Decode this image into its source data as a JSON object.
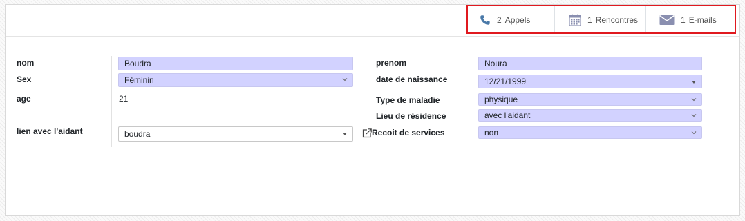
{
  "smart_buttons": [
    {
      "count": "2",
      "label": "Appels",
      "icon": "phone-icon"
    },
    {
      "count": "1",
      "label": "Rencontres",
      "icon": "calendar-icon"
    },
    {
      "count": "1",
      "label": "E-mails",
      "icon": "envelope-icon"
    }
  ],
  "form": {
    "nom": {
      "label": "nom",
      "value": "Boudra"
    },
    "sex": {
      "label": "Sex",
      "value": "Féminin"
    },
    "age": {
      "label": "age",
      "value": "21"
    },
    "lien": {
      "label": "lien avec l'aidant",
      "value": "boudra"
    },
    "prenom": {
      "label": "prenom",
      "value": "Noura"
    },
    "date_naissance": {
      "label": "date de naissance",
      "value": "12/21/1999"
    },
    "type_maladie": {
      "label": "Type de maladie",
      "value": "physique"
    },
    "lieu_residence": {
      "label": "Lieu de résidence",
      "value": "avec l'aidant"
    },
    "recoit_services": {
      "label": "Recoit de services",
      "value": "non"
    }
  },
  "colors": {
    "field_bg": "#d2d2ff",
    "highlight_border": "#e0191f",
    "icon_color": "#8a8fb0",
    "phone_icon_color": "#4a79a8"
  }
}
